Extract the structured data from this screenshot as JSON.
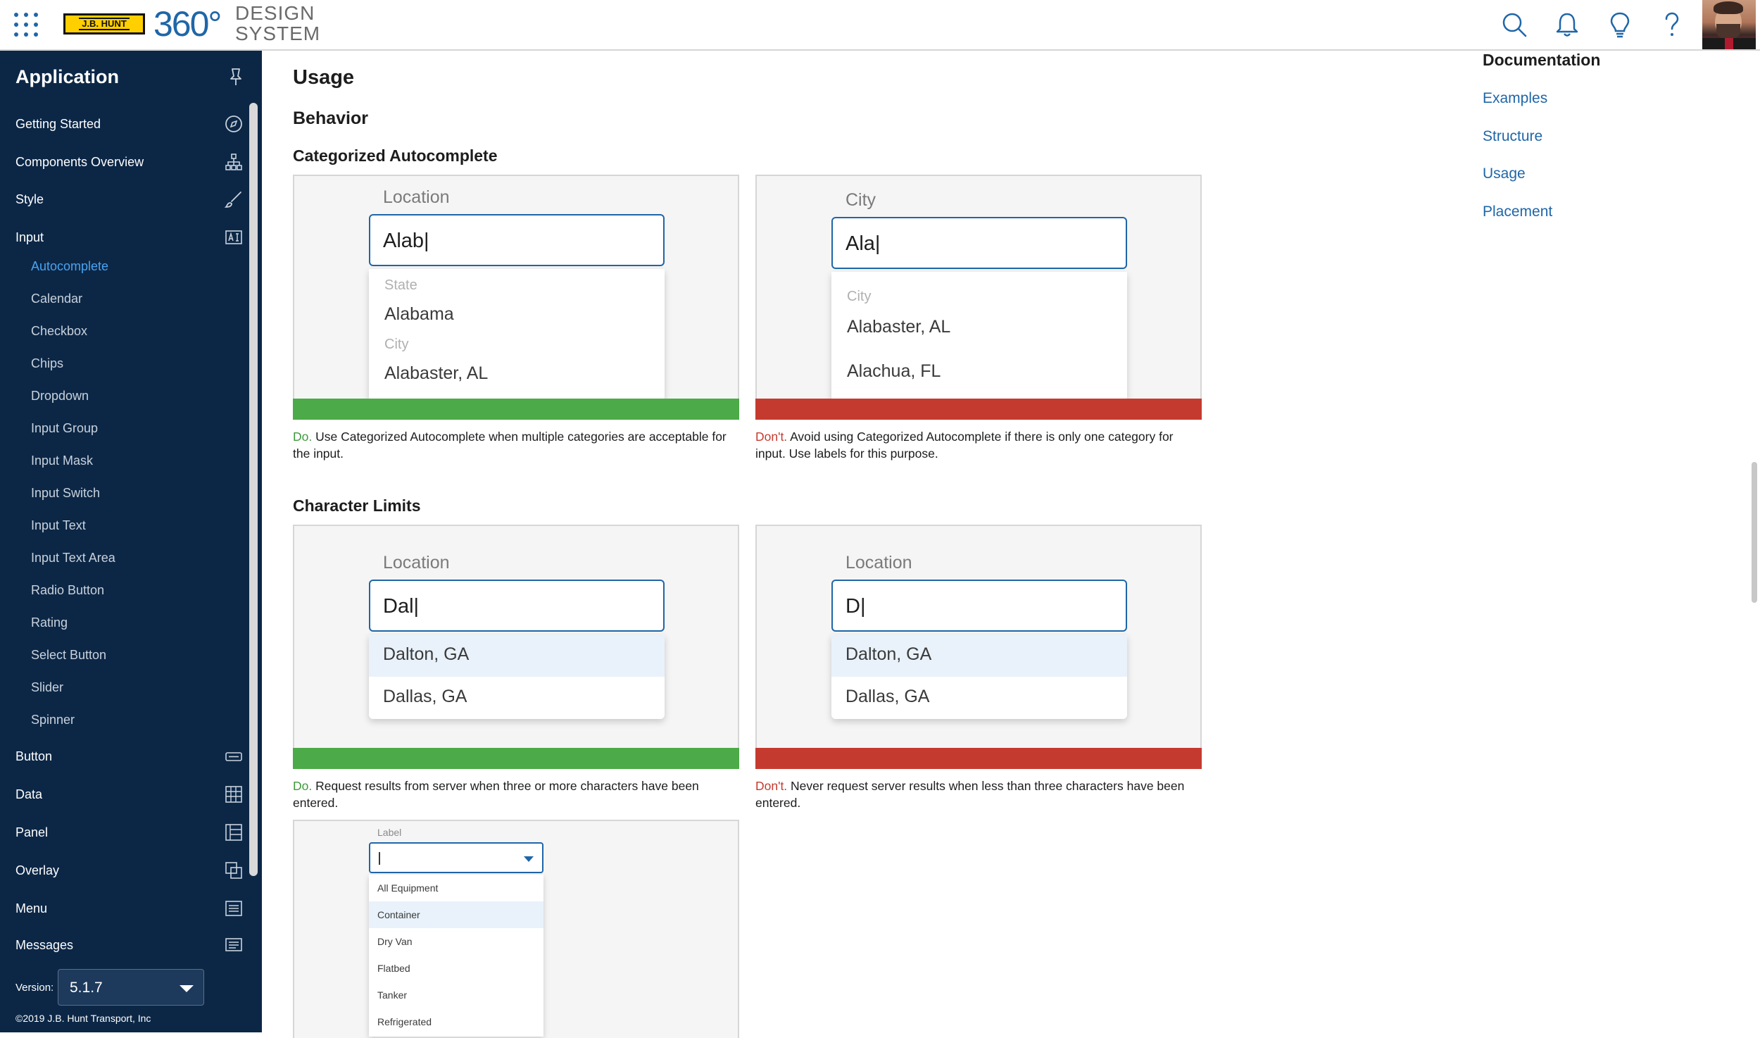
{
  "header": {
    "logo_jbh": "J.B. HUNT",
    "logo_360": "360°",
    "logo_ds_line1": "DESIGN",
    "logo_ds_line2": "SYSTEM",
    "icons": [
      "apps-grid-icon",
      "search-icon",
      "bell-icon",
      "lightbulb-icon",
      "help-icon"
    ]
  },
  "sidebar": {
    "title": "Application",
    "items_top": [
      {
        "label": "Getting Started",
        "icon": "compass-icon"
      },
      {
        "label": "Components Overview",
        "icon": "sitemap-icon"
      },
      {
        "label": "Style",
        "icon": "brush-icon"
      },
      {
        "label": "Input",
        "icon": "text-input-icon"
      }
    ],
    "sub_items": [
      {
        "label": "Autocomplete",
        "active": true
      },
      {
        "label": "Calendar"
      },
      {
        "label": "Checkbox"
      },
      {
        "label": "Chips"
      },
      {
        "label": "Dropdown"
      },
      {
        "label": "Input Group"
      },
      {
        "label": "Input Mask"
      },
      {
        "label": "Input Switch"
      },
      {
        "label": "Input Text"
      },
      {
        "label": "Input Text Area"
      },
      {
        "label": "Radio Button"
      },
      {
        "label": "Rating"
      },
      {
        "label": "Select Button"
      },
      {
        "label": "Slider"
      },
      {
        "label": "Spinner"
      }
    ],
    "items_bottom": [
      {
        "label": "Button",
        "icon": "button-icon"
      },
      {
        "label": "Data",
        "icon": "table-icon"
      },
      {
        "label": "Panel",
        "icon": "panel-icon"
      },
      {
        "label": "Overlay",
        "icon": "overlay-icon"
      },
      {
        "label": "Menu",
        "icon": "menu-icon"
      },
      {
        "label": "Messages",
        "icon": "messages-icon"
      }
    ],
    "version_label": "Version:",
    "version_value": "5.1.7",
    "copyright": "©2019 J.B. Hunt Transport, Inc"
  },
  "main": {
    "title": "Usage",
    "behavior": "Behavior",
    "section1": {
      "title": "Categorized Autocomplete",
      "do_example": {
        "label": "Location",
        "value": "Alab|",
        "cat1": "State",
        "opt1": "Alabama",
        "cat2": "City",
        "opt2": "Alabaster, AL"
      },
      "dont_example": {
        "label": "City",
        "value": "Ala|",
        "cat1": "City",
        "opt1": "Alabaster, AL",
        "opt2": "Alachua, FL"
      },
      "do_prefix": "Do.",
      "do_text": " Use Categorized Autocomplete when multiple categories are acceptable for the input.",
      "dont_prefix": "Don't.",
      "dont_text": " Avoid using Categorized Autocomplete if there is only one category for input. Use labels for this purpose."
    },
    "section2": {
      "title": "Character Limits",
      "do_example": {
        "label": "Location",
        "value": "Dal|",
        "opt1": "Dalton, GA",
        "opt2": "Dallas, GA"
      },
      "dont_example": {
        "label": "Location",
        "value": "D|",
        "opt1": "Dalton, GA",
        "opt2": "Dallas, GA"
      },
      "do_prefix": "Do.",
      "do_text": " Request results from server when three or more characters have been entered.",
      "dont_prefix": "Don't.",
      "dont_text": " Never request server results when less than three characters have been entered."
    },
    "section3": {
      "label": "Label",
      "options": [
        "All Equipment",
        "Container",
        "Dry Van",
        "Flatbed",
        "Tanker",
        "Refrigerated"
      ],
      "highlighted": "Container"
    }
  },
  "right_rail": {
    "title": "Documentation",
    "links": [
      "Examples",
      "Structure",
      "Usage",
      "Placement"
    ]
  },
  "colors": {
    "sidebar_bg": "#0c2746",
    "accent": "#1f66a8",
    "do_green": "#4caa48",
    "dont_red": "#c53a2f",
    "active_link": "#4aa3f0"
  }
}
